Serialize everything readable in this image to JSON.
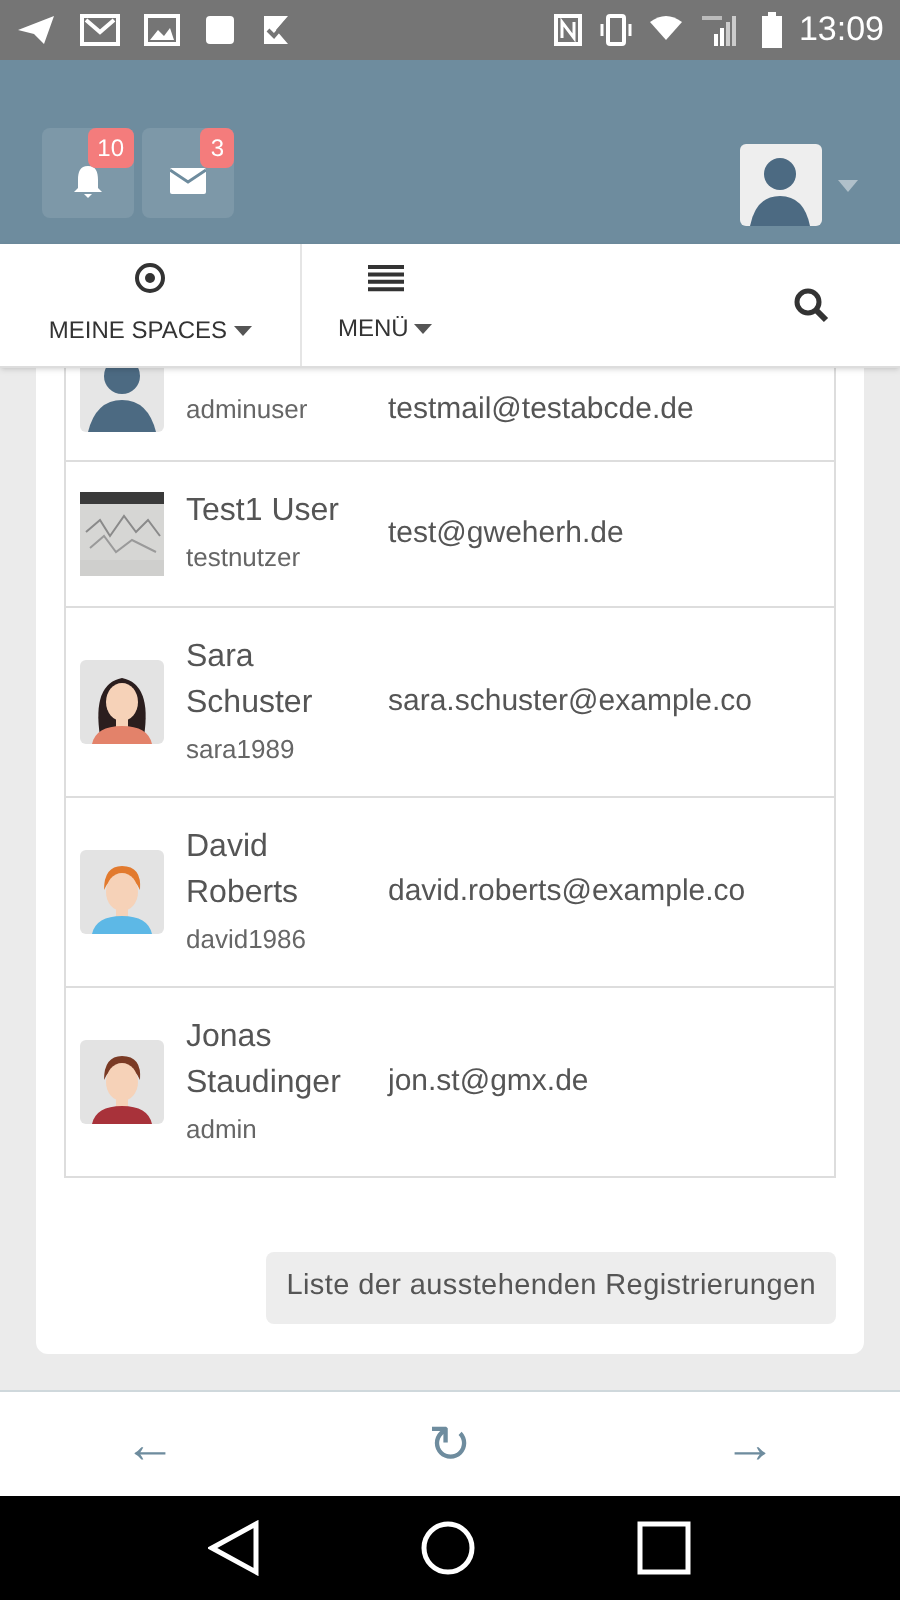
{
  "status_bar": {
    "time": "13:09"
  },
  "header": {
    "notifications": {
      "count": "10"
    },
    "messages": {
      "count": "3"
    }
  },
  "nav": {
    "items": [
      {
        "label": "MEINE SPACES",
        "kind": "target"
      },
      {
        "label": "MENÜ",
        "kind": "list"
      }
    ]
  },
  "users": [
    {
      "username": "adminuser",
      "email": "testmail@testabcde.de",
      "kind": "silhouette"
    },
    {
      "name": "Test1 User",
      "username": "testnutzer",
      "email": "test@gweherh.de",
      "kind": "picture"
    },
    {
      "name": "Sara Schuster",
      "username": "sara1989",
      "email": "sara.schuster@example.co",
      "kind": "woman"
    },
    {
      "name": "David Roberts",
      "username": "david1986",
      "email": "david.roberts@example.co",
      "kind": "man_ginger"
    },
    {
      "name": "Jonas Staudinger",
      "username": "admin",
      "email": "jon.st@gmx.de",
      "kind": "man_brown"
    }
  ],
  "pending_button": "Liste der ausstehenden Registrierungen",
  "browser_nav": {
    "back": "←",
    "reload": "↻",
    "forward": "→"
  }
}
